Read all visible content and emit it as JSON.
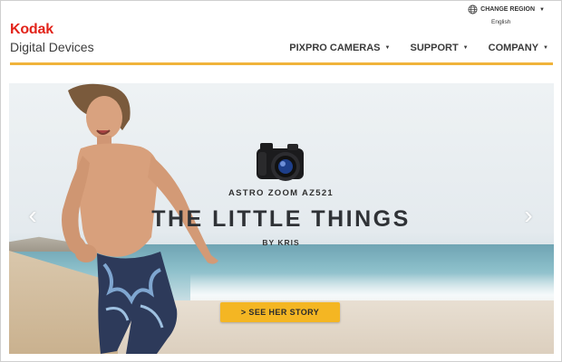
{
  "brand": {
    "name": "Kodak",
    "subtitle": "Digital Devices",
    "color": "#e2231a"
  },
  "region": {
    "label": "CHANGE REGION",
    "language": "English",
    "icon": "globe-icon"
  },
  "nav": {
    "items": [
      {
        "label": "PIXPRO CAMERAS",
        "icon": "chevron-down-icon"
      },
      {
        "label": "SUPPORT",
        "icon": "chevron-down-icon"
      },
      {
        "label": "COMPANY",
        "icon": "chevron-down-icon"
      }
    ],
    "accent_color": "#f0b33a"
  },
  "hero": {
    "product": "ASTRO ZOOM AZ521",
    "headline": "THE LITTLE THINGS",
    "byline": "BY KRIS",
    "cta_label": "> SEE HER STORY",
    "cta_color": "#f4b623",
    "prev_icon": "chevron-left-icon",
    "next_icon": "chevron-right-icon"
  }
}
